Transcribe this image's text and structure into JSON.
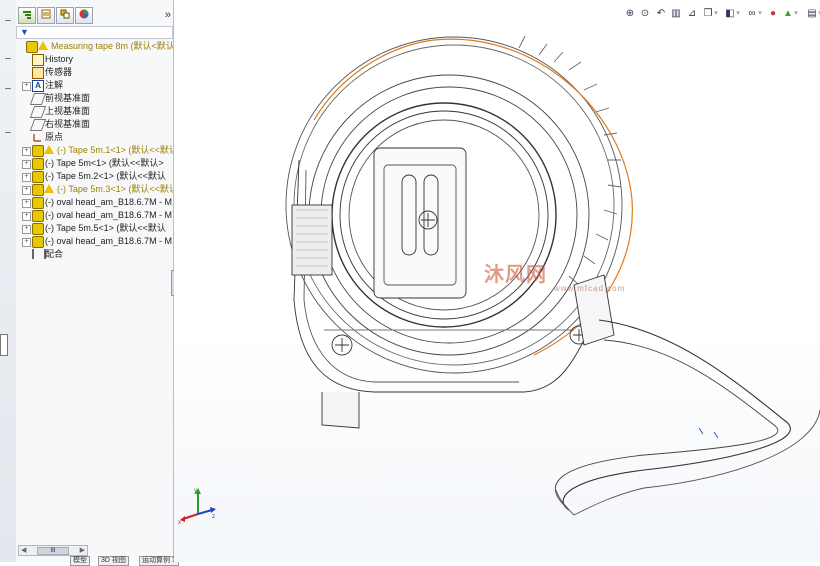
{
  "left_panel": {
    "tabs": [
      "feature-manager",
      "property-manager",
      "configuration-manager",
      "display-manager"
    ],
    "collapse_label": "»",
    "filter_label": "▼",
    "tree": [
      {
        "label": "Measuring tape 8m  (默认<默认",
        "style": "yellow",
        "icon": "part-warning",
        "expand": ""
      },
      {
        "label": "History",
        "style": "dark",
        "icon": "history",
        "expand": ""
      },
      {
        "label": "传感器",
        "style": "dark",
        "icon": "sensor",
        "expand": ""
      },
      {
        "label": "注解",
        "style": "dark",
        "icon": "annotation",
        "expand": "+"
      },
      {
        "label": "前视基准面",
        "style": "dark",
        "icon": "plane",
        "expand": ""
      },
      {
        "label": "上视基准面",
        "style": "dark",
        "icon": "plane",
        "expand": ""
      },
      {
        "label": "右视基准面",
        "style": "dark",
        "icon": "plane",
        "expand": ""
      },
      {
        "label": "原点",
        "style": "dark",
        "icon": "origin",
        "expand": ""
      },
      {
        "label": "(-) Tape 5m.1<1> (默认<<默认",
        "style": "yellow",
        "icon": "part-warning",
        "expand": "+"
      },
      {
        "label": "(-) Tape 5m<1> (默认<<默认>",
        "style": "dark",
        "icon": "part",
        "expand": "+"
      },
      {
        "label": "(-) Tape 5m.2<1> (默认<<默认",
        "style": "dark",
        "icon": "part",
        "expand": "+"
      },
      {
        "label": "(-) Tape 5m.3<1> (默认<<默认",
        "style": "yellow",
        "icon": "part-warning",
        "expand": "+"
      },
      {
        "label": "(-) oval head_am_B18.6.7M - M",
        "style": "dark",
        "icon": "part",
        "expand": "+"
      },
      {
        "label": "(-) oval head_am_B18.6.7M - M",
        "style": "dark",
        "icon": "part",
        "expand": "+"
      },
      {
        "label": "(-) Tape 5m.5<1> (默认<<默认",
        "style": "dark",
        "icon": "part",
        "expand": "+"
      },
      {
        "label": "(-) oval head_am_B18.6.7M - M",
        "style": "dark",
        "icon": "part",
        "expand": "+"
      },
      {
        "label": "配合",
        "style": "dark",
        "icon": "mate",
        "expand": ""
      }
    ],
    "scrollbar_label": "III",
    "bottom_tabs": [
      "模型",
      "3D 视图",
      "运动算例 1"
    ]
  },
  "viewport": {
    "toolbar_icons": [
      "zoom-to-fit-icon",
      "zoom-area-icon",
      "previous-view-icon",
      "section-view-icon",
      "dynamic-annotation-icon",
      "view-orientation-icon",
      "display-style-icon",
      "hide-show-icon",
      "edit-appearance-icon",
      "apply-scene-icon",
      "view-settings-icon"
    ],
    "watermark": "沐风网",
    "watermark_url": "www.mfcad.com",
    "triad_labels": {
      "x": "x",
      "y": "y",
      "z": "z"
    },
    "colors": {
      "edge": "#333333",
      "highlight": "#e07a1a",
      "viewport_bg": "#ffffff"
    }
  }
}
